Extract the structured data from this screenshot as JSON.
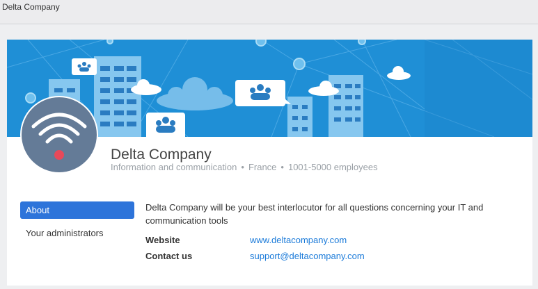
{
  "window": {
    "title": "Delta Company"
  },
  "company": {
    "name": "Delta Company",
    "industry": "Information and communication",
    "country": "France",
    "size": "1001-5000 employees",
    "separator": "•"
  },
  "nav": {
    "about": "About",
    "administrators": "Your administrators"
  },
  "about": {
    "description": "Delta Company will be your best interlocutor for all questions concerning your IT and communication tools",
    "website_label": "Website",
    "website_value": "www.deltacompany.com",
    "contact_label": "Contact us",
    "contact_value": "support@deltacompany.com"
  },
  "icons": {
    "avatar": "wifi-icon",
    "banner_bubbles": "people-group-icon"
  },
  "colors": {
    "banner": "#1f8fd6",
    "accent": "#2d74da",
    "link": "#1a7ad9",
    "avatar_bg": "#647b97",
    "wifi_dot": "#e8495a"
  }
}
